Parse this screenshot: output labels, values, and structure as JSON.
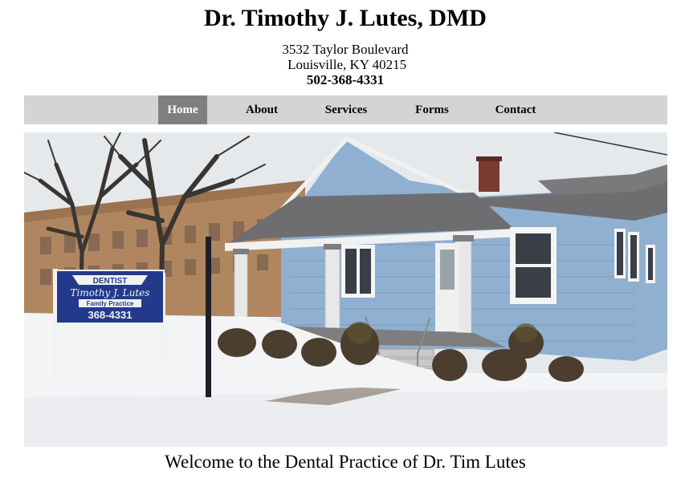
{
  "header": {
    "title": "Dr. Timothy J. Lutes, DMD",
    "address_line1": "3532 Taylor Boulevard",
    "address_line2": " Louisville, KY 40215",
    "phone": "502-368-4331"
  },
  "nav": {
    "items": [
      {
        "label": "Home",
        "active": true
      },
      {
        "label": "About",
        "active": false
      },
      {
        "label": "Services",
        "active": false
      },
      {
        "label": "Forms",
        "active": false
      },
      {
        "label": "Contact",
        "active": false
      }
    ]
  },
  "hero": {
    "sign_line1": "DENTIST",
    "sign_line2": "Timothy J. Lutes",
    "sign_line3": "Family Practice",
    "sign_line4": "368-4331",
    "colors": {
      "siding": "#8fb0d0",
      "roof": "#6e6e70",
      "sign": "#233a8c",
      "sky": "#e6e9ec",
      "snow": "#f3f4f6"
    }
  },
  "main": {
    "welcome": "Welcome to the Dental Practice of Dr. Tim Lutes"
  }
}
